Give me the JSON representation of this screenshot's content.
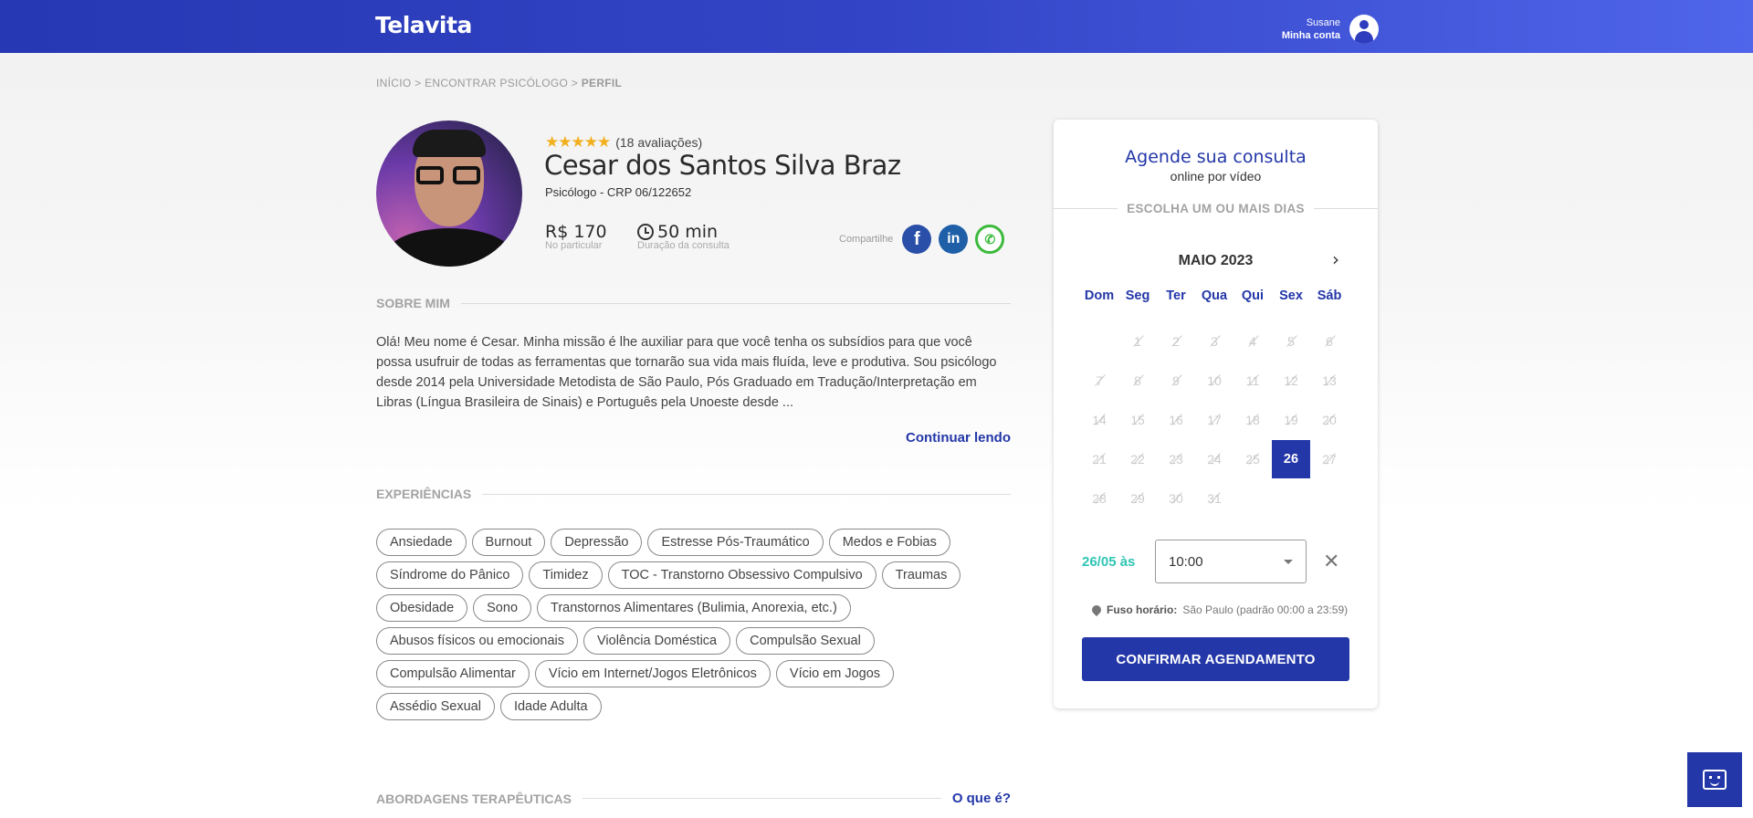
{
  "header": {
    "logo": "Telavita",
    "user_name": "Susane",
    "account_link": "Minha conta",
    "colors": {
      "bar_start": "#2638b3",
      "bar_end": "#4f65ea"
    }
  },
  "breadcrumb": {
    "items": [
      "INÍCIO",
      "ENCONTRAR PSICÓLOGO",
      "PERFIL"
    ],
    "separator": ">"
  },
  "profile": {
    "stars": "★★★★★",
    "rating_text": "(18 avaliações)",
    "name": "Cesar dos Santos Silva Braz",
    "title": "Psicólogo - CRP 06/122652",
    "price": "R$ 170",
    "price_note": "No particular",
    "duration": "50 min",
    "duration_note": "Duração da consulta",
    "share_label": "Compartilhe",
    "social_icons": [
      "facebook-icon",
      "linkedin-icon",
      "whatsapp-icon"
    ]
  },
  "about": {
    "heading": "SOBRE MIM",
    "text": "Olá! Meu nome é Cesar. Minha missão é lhe auxiliar para que você tenha os subsídios para que você possa usufruir de todas as ferramentas que tornarão sua vida mais fluída, leve e produtiva. Sou psicólogo desde 2014 pela Universidade Metodista de São Paulo, Pós Graduado em Tradução/Interpretação em Libras (Língua Brasileira de Sinais) e Português pela Unoeste desde ...",
    "continue": "Continuar lendo"
  },
  "experiences": {
    "heading": "EXPERIÊNCIAS",
    "tags": [
      "Ansiedade",
      "Burnout",
      "Depressão",
      "Estresse Pós-Traumático",
      "Medos e Fobias",
      "Síndrome do Pânico",
      "Timidez",
      "TOC - Transtorno Obsessivo Compulsivo",
      "Traumas",
      "Obesidade",
      "Sono",
      "Transtornos Alimentares (Bulimia, Anorexia, etc.)",
      "Abusos físicos ou emocionais",
      "Violência Doméstica",
      "Compulsão Sexual",
      "Compulsão Alimentar",
      "Vício em Internet/Jogos Eletrônicos",
      "Vício em Jogos",
      "Assédio Sexual",
      "Idade Adulta"
    ]
  },
  "approaches": {
    "heading": "ABORDAGENS TERAPÊUTICAS",
    "link": "O que é?"
  },
  "booking": {
    "title": "Agende sua consulta",
    "subtitle": "online por vídeo",
    "days_heading": "ESCOLHA UM OU MAIS DIAS",
    "month": "MAIO 2023",
    "weekdays": [
      "Dom",
      "Seg",
      "Ter",
      "Qua",
      "Qui",
      "Sex",
      "Sáb"
    ],
    "weeks": [
      [
        "",
        "1",
        "2",
        "3",
        "4",
        "5",
        "6"
      ],
      [
        "7",
        "8",
        "9",
        "10",
        "11",
        "12",
        "13"
      ],
      [
        "14",
        "15",
        "16",
        "17",
        "18",
        "19",
        "20"
      ],
      [
        "21",
        "22",
        "23",
        "24",
        "25",
        "26",
        "27"
      ],
      [
        "28",
        "29",
        "30",
        "31",
        "",
        "",
        ""
      ]
    ],
    "selected_day": "26",
    "selected_date_label": "26/05 às",
    "time": "10:00",
    "timezone_label": "Fuso horário:",
    "timezone_value": "São Paulo (padrão 00:00 a 23:59)",
    "confirm": "CONFIRMAR AGENDAMENTO",
    "accent": "#2337a8",
    "date_color": "#2fc5b4"
  }
}
